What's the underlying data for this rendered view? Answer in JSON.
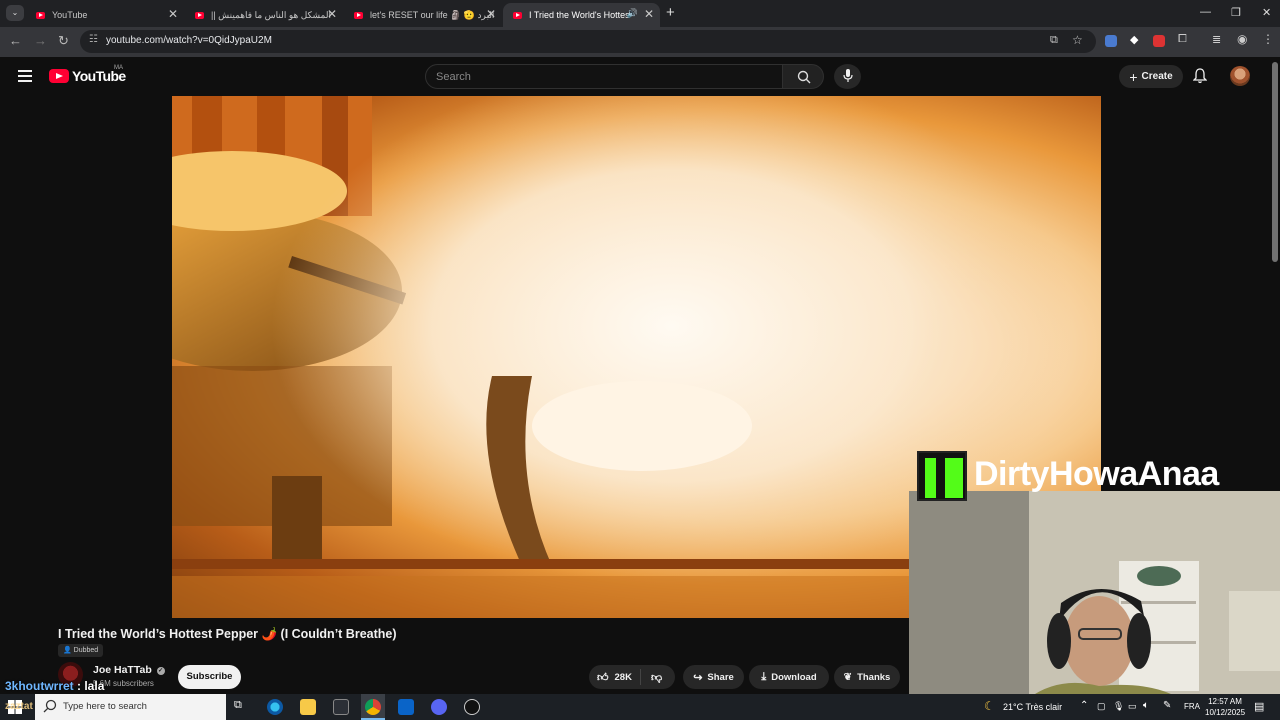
{
  "browser": {
    "tabs": [
      {
        "title": "YouTube",
        "active": false
      },
      {
        "title": "المشكل هو الناس ما فاهمينش ||",
        "active": false
      },
      {
        "title": "let's RESET our life 🗿 🫡 البرد",
        "active": false
      },
      {
        "title": "I Tried the World's Hottest P",
        "active": true
      }
    ],
    "url": "youtube.com/watch?v=0QidJypaU2M"
  },
  "youtube": {
    "logo_text": "YouTube",
    "country_code": "MA",
    "search_placeholder": "Search",
    "create_label": "Create"
  },
  "video": {
    "title": "I Tried the World’s Hottest Pepper 🌶️ (I Couldn’t Breathe)",
    "badge": "Dubbed",
    "channel_name": "Joe HaTTab",
    "verified": true,
    "subscribers": "5.6M subscribers",
    "subscribe_label": "Subscribe",
    "likes": "28K",
    "share_label": "Share",
    "download_label": "Download",
    "thanks_label": "Thanks"
  },
  "stream_overlay": {
    "streamer_name": "DirtyHowaAnaa",
    "platform_icon": "kick-logo",
    "chat": {
      "user": "3khoutwrret",
      "message": " : lala"
    },
    "small_text": "zaztat"
  },
  "taskbar": {
    "search_placeholder": "Type here to search",
    "weather": "21°C  Très clair",
    "language": "FRA",
    "time": "12:57 AM",
    "date": "10/12/2025"
  },
  "colors": {
    "youtube_red": "#ff0033",
    "kick_green": "#53fc18",
    "page_bg": "#0f0f0f"
  }
}
